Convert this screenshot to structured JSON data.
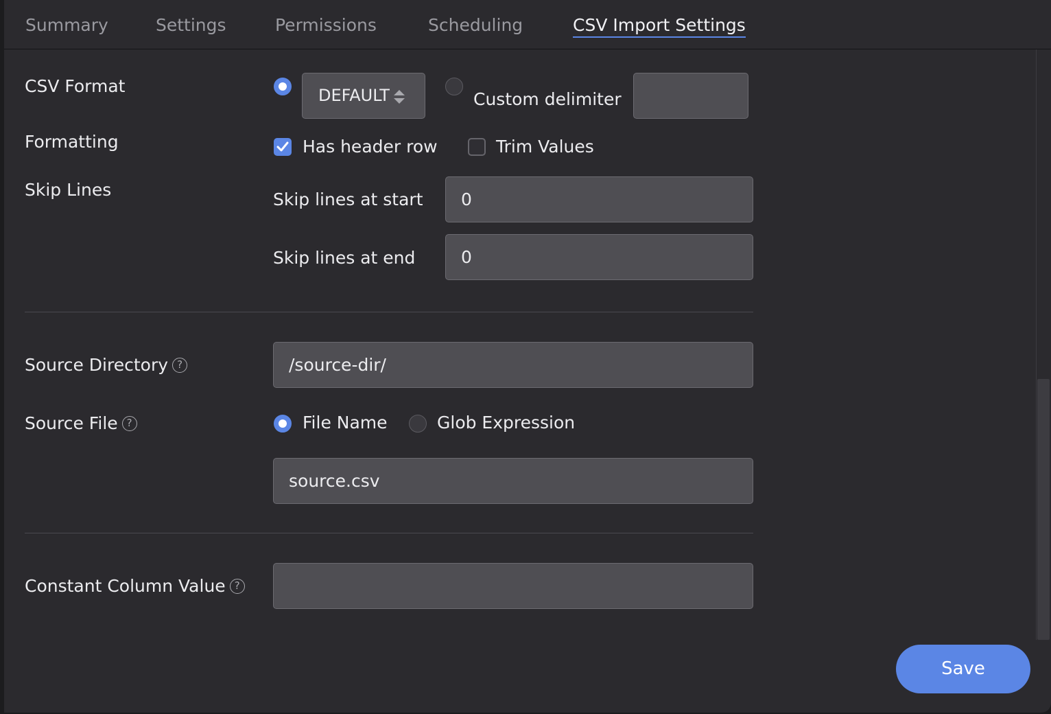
{
  "tabs": [
    {
      "label": "Summary",
      "active": false
    },
    {
      "label": "Settings",
      "active": false
    },
    {
      "label": "Permissions",
      "active": false
    },
    {
      "label": "Scheduling",
      "active": false
    },
    {
      "label": "CSV Import Settings",
      "active": true
    }
  ],
  "csv_format": {
    "label": "CSV Format",
    "default_selected": true,
    "select_value": "DEFAULT",
    "custom_label": "Custom delimiter",
    "custom_value": ""
  },
  "formatting": {
    "label": "Formatting",
    "has_header_label": "Has header row",
    "has_header_checked": true,
    "trim_label": "Trim Values",
    "trim_checked": false
  },
  "skip_lines": {
    "label": "Skip Lines",
    "start_label": "Skip lines at start",
    "start_value": "0",
    "end_label": "Skip lines at end",
    "end_value": "0"
  },
  "source_directory": {
    "label": "Source Directory",
    "help": "?",
    "value": "/source-dir/"
  },
  "source_file": {
    "label": "Source File",
    "help": "?",
    "file_name_label": "File Name",
    "file_name_selected": true,
    "glob_label": "Glob Expression",
    "value": "source.csv"
  },
  "constant_column": {
    "label": "Constant Column Value",
    "help": "?",
    "value": ""
  },
  "save_label": "Save",
  "colors": {
    "accent": "#5b86e5",
    "background": "#2b2a2e",
    "input": "#4f4e53"
  }
}
